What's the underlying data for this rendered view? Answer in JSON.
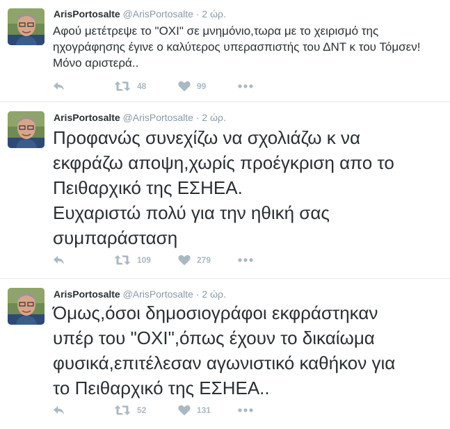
{
  "tweets": [
    {
      "name": "ArisPortosalte",
      "handle": "@ArisPortosalte",
      "separator": "·",
      "time": "2 ώρ.",
      "text_lines": [
        "Αφού μετέτρεψε το \"ΟΧΙ\" σε μνημόνιο,τωρα με το χειρισμό της",
        "ηχογράφησης έγινε ο καλύτερος υπερασπιστής του ΔΝΤ κ του Τόμσεν!",
        "Μόνο αριστερά.."
      ],
      "retweets": "48",
      "likes": "99"
    },
    {
      "name": "ArisPortosalte",
      "handle": "@ArisPortosalte",
      "separator": "·",
      "time": "2 ώρ.",
      "text_lines": [
        "Προφανώς συνεχίζω να σχολιάζω κ να",
        "εκφράζω αποψη,χωρίς προέγκριση απο το",
        "Πειθαρχικό της ΕΣΗΕΑ.",
        "Ευχαριστώ πολύ για την ηθική σας",
        "συμπαράσταση"
      ],
      "retweets": "109",
      "likes": "279"
    },
    {
      "name": "ArisPortosalte",
      "handle": "@ArisPortosalte",
      "separator": "·",
      "time": "2 ώρ.",
      "text_lines": [
        "Όμως,όσοι δημοσιογράφοι εκφράστηκαν",
        "υπέρ του \"ΟΧΙ\",όπως έχουν το δικαίωμα",
        "φυσικά,επιτέλεσαν αγωνιστικό καθήκον για",
        "το Πειθαρχικό της ΕΣΗΕΑ.."
      ],
      "retweets": "52",
      "likes": "131"
    }
  ],
  "icons": {
    "reply": "reply-icon",
    "retweet": "retweet-icon",
    "like": "heart-icon",
    "more": "more-icon"
  },
  "colors": {
    "text": "#292f33",
    "meta": "#8899a6",
    "action": "#aab8c2",
    "divider": "#e1e8ed"
  }
}
